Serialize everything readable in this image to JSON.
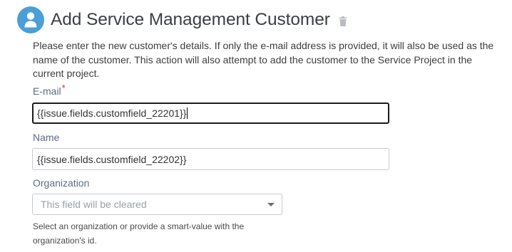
{
  "header": {
    "title": "Add Service Management Customer",
    "avatar_icon": "user-icon",
    "delete_icon": "trash-icon"
  },
  "description": "Please enter the new customer's details. If only the e-mail address is provided, it will also be used as the name of the customer. This action will also attempt to add the customer to the Service Project in the current project.",
  "email": {
    "label": "E-mail",
    "required_mark": "*",
    "value": "{{issue.fields.customfield_22201}}"
  },
  "name": {
    "label": "Name",
    "value": "{{issue.fields.customfield_22202}}"
  },
  "organization": {
    "label": "Organization",
    "placeholder": "This field will be cleared",
    "help": "Select an organization or provide a smart-value with the organization's id."
  },
  "colors": {
    "avatar": "#4a9fd8",
    "required": "#de350b",
    "focus_border": "#1b1b1b"
  }
}
